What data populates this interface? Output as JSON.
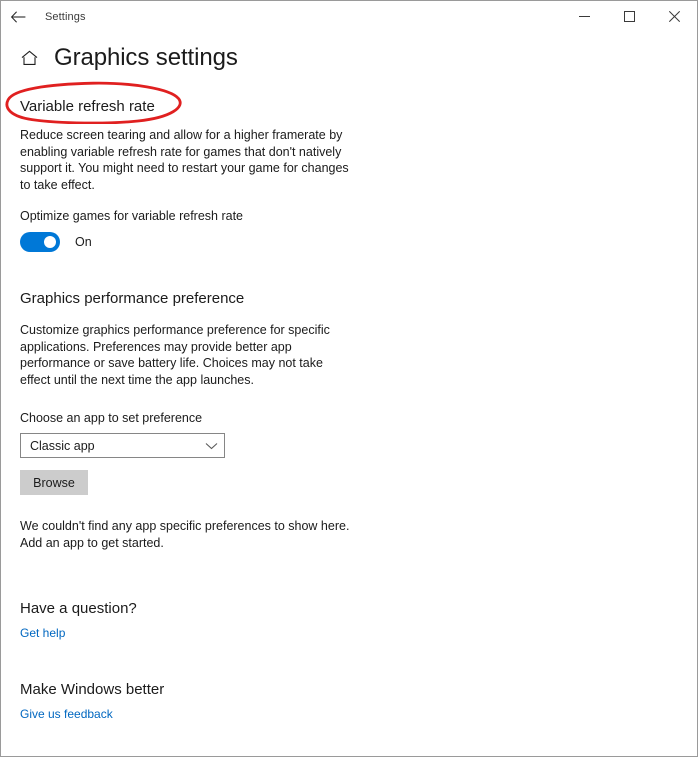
{
  "titlebar": {
    "back_icon": "back-arrow-icon",
    "title": "Settings",
    "minimize_icon": "minimize-icon",
    "maximize_icon": "maximize-icon",
    "close_icon": "close-icon"
  },
  "header": {
    "home_icon": "home-icon",
    "title": "Graphics settings"
  },
  "variable_refresh_rate": {
    "heading": "Variable refresh rate",
    "description": "Reduce screen tearing and allow for a higher framerate by enabling variable refresh rate for games that don't natively support it. You might need to restart your game for changes to take effect.",
    "toggle_label": "Optimize games for variable refresh rate",
    "toggle_state": "On",
    "toggle_on": true
  },
  "graphics_performance": {
    "heading": "Graphics performance preference",
    "description": "Customize graphics performance preference for specific applications. Preferences may provide better app performance or save battery life. Choices may not take effect until the next time the app launches.",
    "field_label": "Choose an app to set preference",
    "dropdown_value": "Classic app",
    "dropdown_icon": "chevron-down-icon",
    "browse_label": "Browse",
    "empty_note": "We couldn't find any app specific preferences to show here. Add an app to get started."
  },
  "have_a_question": {
    "heading": "Have a question?",
    "link_label": "Get help"
  },
  "make_windows_better": {
    "heading": "Make Windows better",
    "link_label": "Give us feedback"
  },
  "annotation": {
    "shape": "ellipse-highlight",
    "color": "#e02020",
    "target": "Variable refresh rate"
  },
  "colors": {
    "accent": "#0078d7",
    "link": "#0067c0",
    "annotation": "#e02020",
    "button_face": "#cccccc",
    "text": "#1b1b1b"
  }
}
